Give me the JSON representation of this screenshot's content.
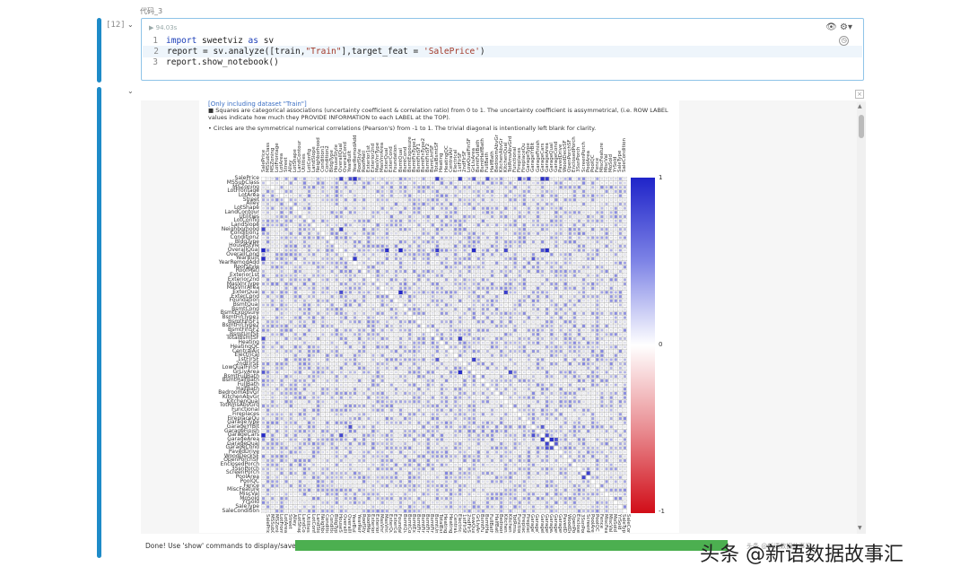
{
  "cell": {
    "title": "代码_3",
    "exec_count": "[12]",
    "run_time": "94.03s",
    "code_lines": [
      {
        "n": "1",
        "parts": [
          [
            "kw",
            "import"
          ],
          [
            "t",
            " sweetviz "
          ],
          [
            "kw",
            "as"
          ],
          [
            "t",
            " sv"
          ]
        ]
      },
      {
        "n": "2",
        "parts": [
          [
            "t",
            "report = sv.analyze([train,"
          ],
          [
            "str",
            "\"Train\""
          ],
          [
            "t",
            "],target_feat = "
          ],
          [
            "str",
            "'SalePrice'"
          ],
          [
            "t",
            ")"
          ]
        ]
      },
      {
        "n": "3",
        "parts": [
          [
            "t",
            "report.show_notebook()"
          ]
        ]
      }
    ]
  },
  "report": {
    "line1": "[Only including dataset \"Train\"]",
    "line2": "■ Squares are categorical associations (uncertainty coefficient & correlation ratio) from 0 to 1. The uncertainty coefficient is assymmetrical, (i.e. ROW LABEL values indicate how much they PROVIDE INFORMATION to each LABEL at the TOP).",
    "line3": "• Circles are the symmetrical numerical correlations (Pearson's) from -1 to 1. The trivial diagonal is intentionally left blank for clarity.",
    "features": [
      "SalePrice",
      "MSSubClass",
      "MSZoning",
      "LotFrontage",
      "LotArea",
      "Street",
      "Alley",
      "LotShape",
      "LandContour",
      "Utilities",
      "LotConfig",
      "LandSlope",
      "Neighborhood",
      "Condition1",
      "Condition2",
      "BldgType",
      "HouseStyle",
      "OverallQual",
      "OverallCond",
      "YearBuilt",
      "YearRemodAdd",
      "RoofStyle",
      "RoofMatl",
      "Exterior1st",
      "Exterior2nd",
      "MasVnrType",
      "MasVnrArea",
      "ExterQual",
      "ExterCond",
      "Foundation",
      "BsmtQual",
      "BsmtCond",
      "BsmtExposure",
      "BsmtFinType1",
      "BsmtFinSF1",
      "BsmtFinType2",
      "BsmtFinSF2",
      "BsmtUnfSF",
      "TotalBsmtSF",
      "Heating",
      "HeatingQC",
      "CentralAir",
      "Electrical",
      "1stFlrSF",
      "2ndFlrSF",
      "LowQualFinSF",
      "GrLivArea",
      "BsmtFullBath",
      "BsmtHalfBath",
      "FullBath",
      "HalfBath",
      "BedroomAbvGr",
      "KitchenAbvGr",
      "KitchenQual",
      "TotRmsAbvGrd",
      "Functional",
      "Fireplaces",
      "FireplaceQu",
      "GarageType",
      "GarageYrBlt",
      "GarageFinish",
      "GarageCars",
      "GarageArea",
      "GarageQual",
      "GarageCond",
      "PavedDrive",
      "WoodDeckSF",
      "OpenPorchSF",
      "EnclosedPorch",
      "3SsnPorch",
      "ScreenPorch",
      "PoolArea",
      "PoolQC",
      "Fence",
      "MiscFeature",
      "MiscVal",
      "MoSold",
      "YrSold",
      "SaleType",
      "SaleCondition"
    ],
    "colorbar": {
      "max": "1",
      "mid": "0",
      "min": "-1"
    }
  },
  "status": {
    "text": "Done! Use 'show' commands to display/save.",
    "progress": 1.0,
    "color": "#4caf50"
  },
  "watermark": "头条 @新语数据故事汇",
  "watermark_small": "头条 @新语数据故事汇"
}
